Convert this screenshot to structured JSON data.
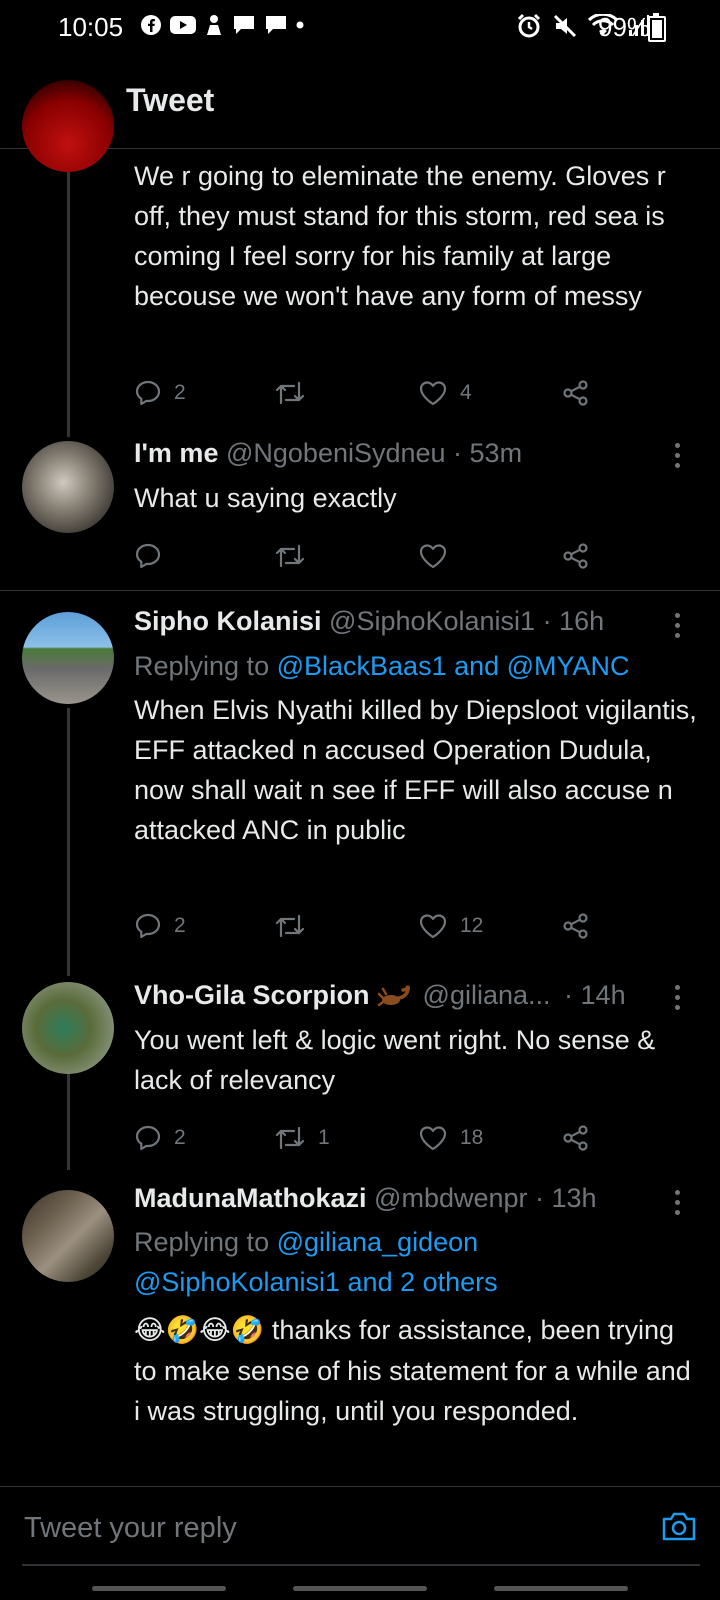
{
  "status": {
    "time": "10:05",
    "battery": "99%"
  },
  "header": {
    "title": "Tweet"
  },
  "tweets": [
    {
      "text": "We r going to eleminate the enemy. Gloves r off, they must stand for this storm, red sea is coming I feel sorry for his family at large becouse we won't have any form of messy",
      "reply_count": "2",
      "retweet_count": "",
      "like_count": "4"
    },
    {
      "name": "I'm me",
      "handle": "@NgobeniSydneu · 53m",
      "text": "What u saying exactly",
      "reply_count": "",
      "retweet_count": "",
      "like_count": ""
    },
    {
      "name": "Sipho Kolanisi",
      "handle": "@SiphoKolanisi1 · 16h",
      "replying_prefix": "Replying to ",
      "replying_to": "@BlackBaas1 and @MYANC",
      "text": "When Elvis Nyathi killed by Diepsloot vigilantis,  EFF attacked n accused Operation Dudula, now shall wait n see if EFF will also accuse n attacked ANC in public",
      "reply_count": "2",
      "retweet_count": "",
      "like_count": "12"
    },
    {
      "name": "Vho-Gila Scorpion",
      "handle": "@giliana...",
      "time": "· 14h",
      "text": "You went left & logic went right. No sense & lack of relevancy",
      "reply_count": "2",
      "retweet_count": "1",
      "like_count": "18"
    },
    {
      "name": "MadunaMathokazi",
      "handle": "@mbdwenpr · 13h",
      "replying_prefix": "Replying to ",
      "replying_to_line1": "@giliana_gideon",
      "replying_to_line2": "@SiphoKolanisi1 and 2 others",
      "emoji": "😂🤣😂🤣",
      "text": " thanks for assistance, been trying to make sense of his statement for a while and i was struggling, until you responded."
    }
  ],
  "reply_bar": {
    "placeholder": "Tweet your reply"
  }
}
